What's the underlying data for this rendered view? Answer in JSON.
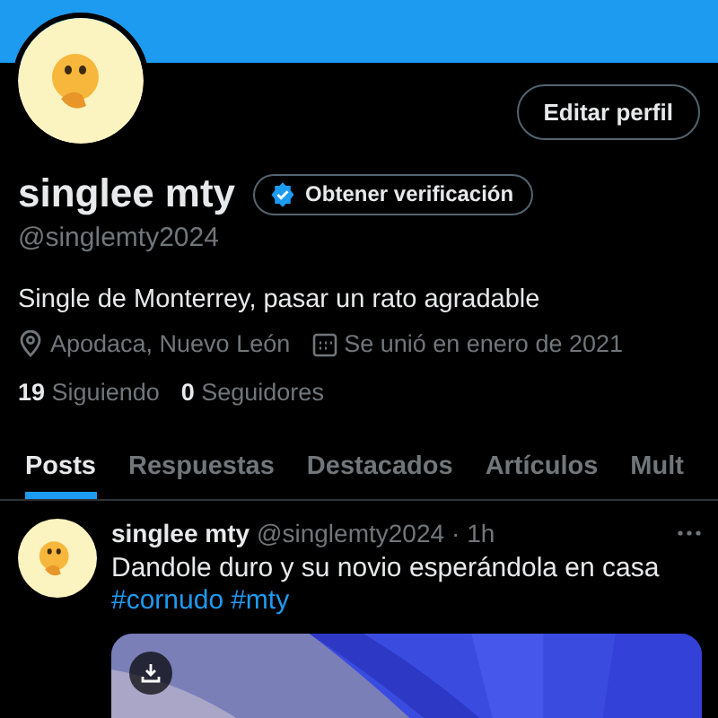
{
  "profile": {
    "name": "singlee mty",
    "verify_button": "Obtener verificación",
    "edit_button": "Editar perfil",
    "handle": "@singlemty2024",
    "bio": "Single de Monterrey, pasar un rato agradable",
    "location": "Apodaca, Nuevo León",
    "joined": "Se unió en enero de 2021",
    "following_count": "19",
    "following_label": "Siguiendo",
    "followers_count": "0",
    "followers_label": "Seguidores"
  },
  "tabs": [
    {
      "label": "Posts",
      "selected": true
    },
    {
      "label": "Respuestas",
      "selected": false
    },
    {
      "label": "Destacados",
      "selected": false
    },
    {
      "label": "Artículos",
      "selected": false
    },
    {
      "label": "Mult",
      "selected": false
    }
  ],
  "post": {
    "name": "singlee mty",
    "handle": "@singlemty2024",
    "time": "· 1h",
    "text": "Dandole duro y su novio esperándola en casa",
    "hashtags": [
      "#cornudo",
      "#mty"
    ]
  }
}
